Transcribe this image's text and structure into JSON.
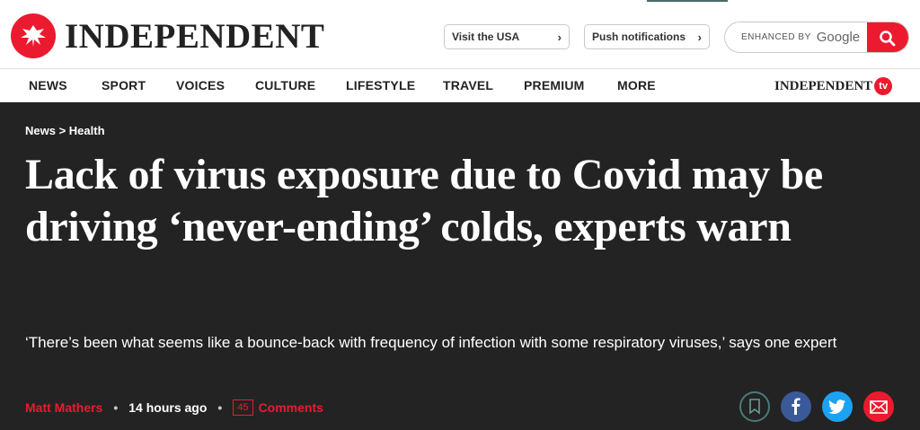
{
  "header": {
    "logo_text": "INDEPENDENT",
    "visit_label": "Visit the USA",
    "push_label": "Push notifications",
    "search_enhanced": "ENHANCED BY",
    "search_google": "Google"
  },
  "nav": {
    "items": [
      {
        "label": "NEWS"
      },
      {
        "label": "SPORT"
      },
      {
        "label": "VOICES"
      },
      {
        "label": "CULTURE"
      },
      {
        "label": "LIFESTYLE"
      },
      {
        "label": "TRAVEL"
      },
      {
        "label": "PREMIUM"
      },
      {
        "label": "MORE"
      }
    ],
    "tv_text": "INDEPENDENT",
    "tv_badge": "tv"
  },
  "article": {
    "breadcrumb": "News > Health",
    "headline": "Lack of virus exposure due to Covid may be driving ‘never-ending’ colds, experts warn",
    "standfirst": "‘There’s been what seems like a bounce-back with frequency of infection with some respiratory viruses,’ says one expert",
    "author": "Matt Mathers",
    "time": "14 hours ago",
    "comment_count": "45",
    "comment_label": "Comments"
  },
  "colors": {
    "brand_red": "#ec1a2e",
    "hero_bg": "#232323",
    "facebook": "#3b5998",
    "twitter": "#1da1f2"
  },
  "icons": [
    "eagle-logo-icon",
    "chevron-right-icon",
    "search-icon",
    "bookmark-icon",
    "facebook-icon",
    "twitter-icon",
    "email-icon"
  ]
}
